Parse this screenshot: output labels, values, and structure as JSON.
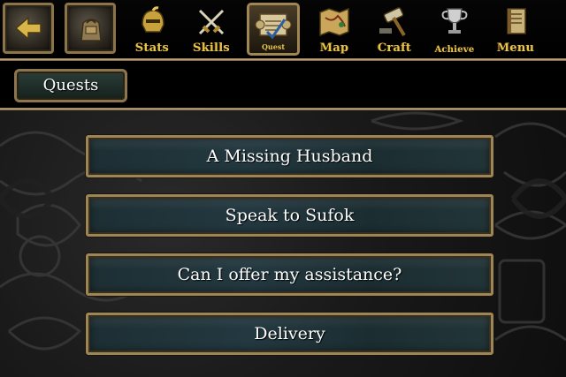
{
  "nav": {
    "stats": "Stats",
    "skills": "Skills",
    "quest": "Quest",
    "map": "Map",
    "craft": "Craft",
    "achieve": "Achieve",
    "menu": "Menu"
  },
  "tab": {
    "label": "Quests"
  },
  "quests": [
    "A Missing Husband",
    "Speak to Sufok",
    "Can I offer my assistance?",
    "Delivery"
  ],
  "colors": {
    "gold_label": "#e9c44a",
    "frame": "#9c8557",
    "button_fill": "#233840"
  },
  "icons": [
    "back-arrow-icon",
    "inventory-icon",
    "stats-helmet-icon",
    "skills-swords-icon",
    "quest-scroll-icon",
    "map-icon",
    "craft-hammer-icon",
    "achieve-trophy-icon",
    "menu-book-icon"
  ]
}
